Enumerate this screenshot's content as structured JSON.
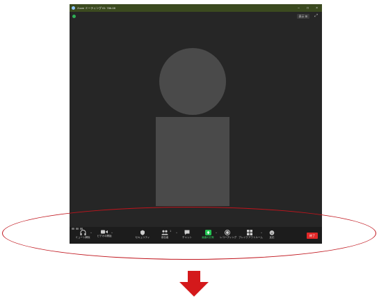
{
  "window": {
    "title": "Zoom ミーティング ID: 786-08",
    "controls": [
      "−",
      "□",
      "×"
    ],
    "view_label": "表示 ⊞"
  },
  "toolbar": {
    "audio_label": "ミュート解除",
    "video_label": "ビデオの開始",
    "security_label": "セキュリティ",
    "participants_label": "参加者",
    "participants_count": "1",
    "chat_label": "チャット",
    "share_label": "画面の共有",
    "record_label": "レコーディング",
    "breakout_label": "ブレイクアウトルーム",
    "reactions_label": "反応",
    "end_label": "終了"
  },
  "colors": {
    "titlebar": "#3b4a1f",
    "window_bg": "#262626",
    "share_green": "#23c552",
    "end_red": "#e02828",
    "annotation_red": "#c0141c",
    "arrow_red": "#d4191b"
  },
  "icons": [
    "shield-icon",
    "fullscreen-icon",
    "headphones-icon",
    "video-icon",
    "security-icon",
    "participants-icon",
    "chat-icon",
    "share-screen-icon",
    "record-icon",
    "breakout-icon",
    "reactions-icon"
  ]
}
